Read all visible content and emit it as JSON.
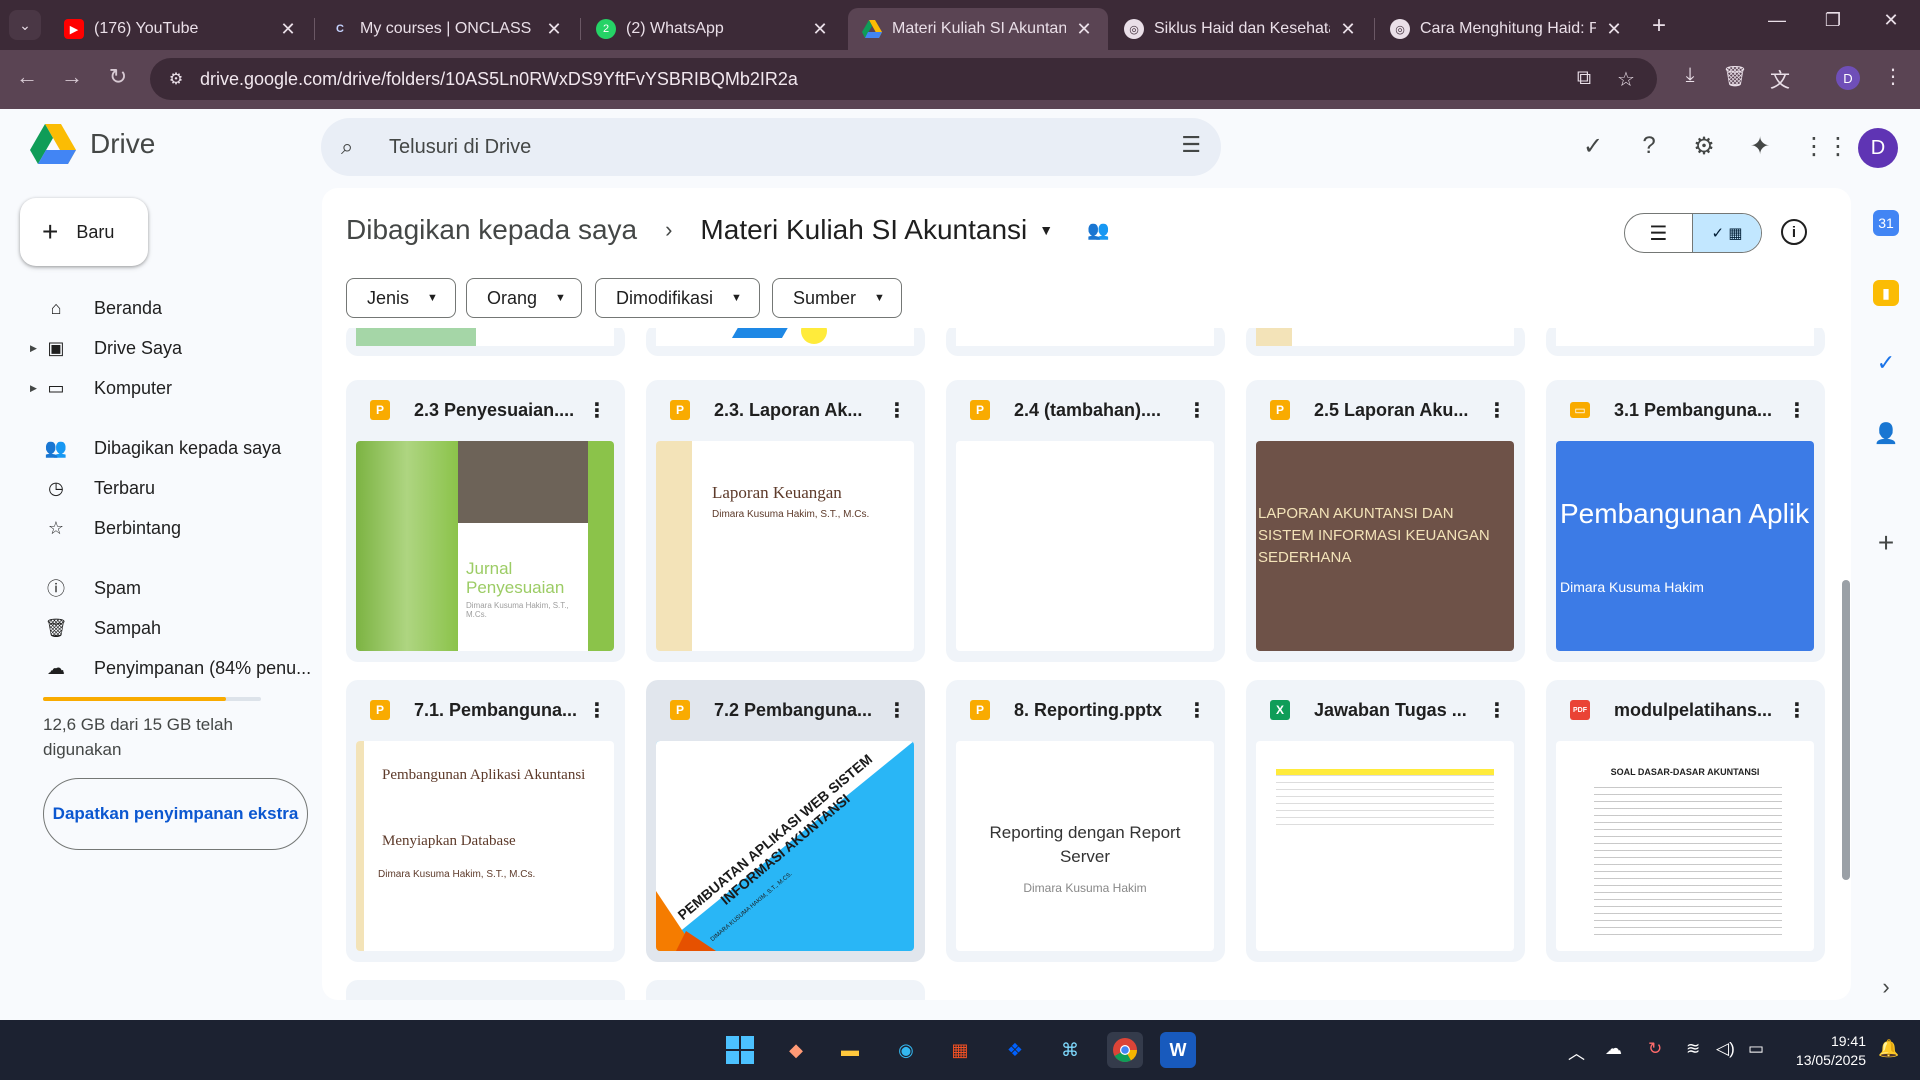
{
  "browser": {
    "tabs": [
      {
        "title": "(176) YouTube",
        "icon": "youtube-icon"
      },
      {
        "title": "My courses | ONCLASS",
        "icon": "onclass-icon"
      },
      {
        "title": "(2) WhatsApp",
        "icon": "whatsapp-icon"
      },
      {
        "title": "Materi Kuliah SI Akuntansi",
        "icon": "google-drive-icon",
        "active": true
      },
      {
        "title": "Siklus Haid dan Kesehatan",
        "icon": "web-icon"
      },
      {
        "title": "Cara Menghitung Haid: Pa",
        "icon": "web-icon"
      }
    ],
    "url": "drive.google.com/drive/folders/10AS5Ln0RWxDS9YftFvYSBRIBQMb2IR2a",
    "profile_initial": "D"
  },
  "drive": {
    "logo_text": "Drive",
    "search_placeholder": "Telusuri di Drive",
    "avatar_initial": "D",
    "new_button": "Baru",
    "nav": [
      {
        "label": "Beranda",
        "icon": "home-icon"
      },
      {
        "label": "Drive Saya",
        "icon": "my-drive-icon"
      },
      {
        "label": "Komputer",
        "icon": "computer-icon"
      },
      {
        "label": "Dibagikan kepada saya",
        "icon": "shared-icon"
      },
      {
        "label": "Terbaru",
        "icon": "clock-icon"
      },
      {
        "label": "Berbintang",
        "icon": "star-icon"
      },
      {
        "label": "Spam",
        "icon": "spam-icon"
      },
      {
        "label": "Sampah",
        "icon": "trash-icon"
      },
      {
        "label": "Penyimpanan (84% penu...",
        "icon": "cloud-icon"
      }
    ],
    "storage_percent": 84,
    "storage_text": "12,6 GB dari 15 GB telah digunakan",
    "get_storage": "Dapatkan penyimpanan ekstra",
    "breadcrumb": {
      "parent": "Dibagikan kepada saya",
      "current": "Materi Kuliah SI Akuntansi"
    },
    "filters": [
      "Jenis",
      "Orang",
      "Dimodifikasi",
      "Sumber"
    ],
    "files": [
      {
        "title": "2.3 Penyesuaian....",
        "type": "slides",
        "thumb_title": "Jurnal Penyesuaian",
        "thumb_sub": "Dimara Kusuma Hakim, S.T., M.Cs."
      },
      {
        "title": "2.3. Laporan Ak...",
        "type": "slides",
        "thumb_title": "Laporan Keuangan",
        "thumb_sub": "Dimara Kusuma Hakim, S.T., M.Cs."
      },
      {
        "title": "2.4 (tambahan)....",
        "type": "slides",
        "thumb_title": "",
        "thumb_sub": ""
      },
      {
        "title": "2.5 Laporan Aku...",
        "type": "slides",
        "thumb_title": "LAPORAN AKUNTANSI DAN SISTEM INFORMASI KEUANGAN SEDERHANA",
        "thumb_sub": ""
      },
      {
        "title": "3.1 Pembanguna...",
        "type": "gslides",
        "thumb_title": "Pembangunan Aplik Akuntansi",
        "thumb_sub": "Dimara Kusuma Hakim"
      },
      {
        "title": "7.1. Pembanguna...",
        "type": "slides",
        "thumb_title": "Pembangunan Aplikasi Akuntansi",
        "thumb_sub": "Menyiapkan Database",
        "thumb_sub2": "Dimara Kusuma Hakim, S.T., M.Cs."
      },
      {
        "title": "7.2 Pembanguna...",
        "type": "slides",
        "thumb_title": "PEMBUATAN APLIKASI WEB SISTEM INFORMASI AKUNTANSI",
        "thumb_sub": "DIMARA KUSUMA HAKIM, S.T., M.CS."
      },
      {
        "title": "8. Reporting.pptx",
        "type": "slides",
        "thumb_title": "Reporting dengan Report Server",
        "thumb_sub": "Dimara Kusuma Hakim"
      },
      {
        "title": "Jawaban Tugas ...",
        "type": "sheets",
        "thumb_title": "",
        "thumb_sub": ""
      },
      {
        "title": "modulpelatihans...",
        "type": "pdf",
        "thumb_title": "SOAL DASAR-DASAR AKUNTANSI",
        "thumb_sub": ""
      }
    ]
  },
  "taskbar": {
    "time": "19:41",
    "date": "13/05/2025"
  },
  "colors": {
    "tabstrip": "#3c2a37",
    "toolbar": "#5a4453",
    "accent": "#0b57d0",
    "selected_toggle": "#c2e7ff",
    "storage_fill": "#f9ab00"
  }
}
